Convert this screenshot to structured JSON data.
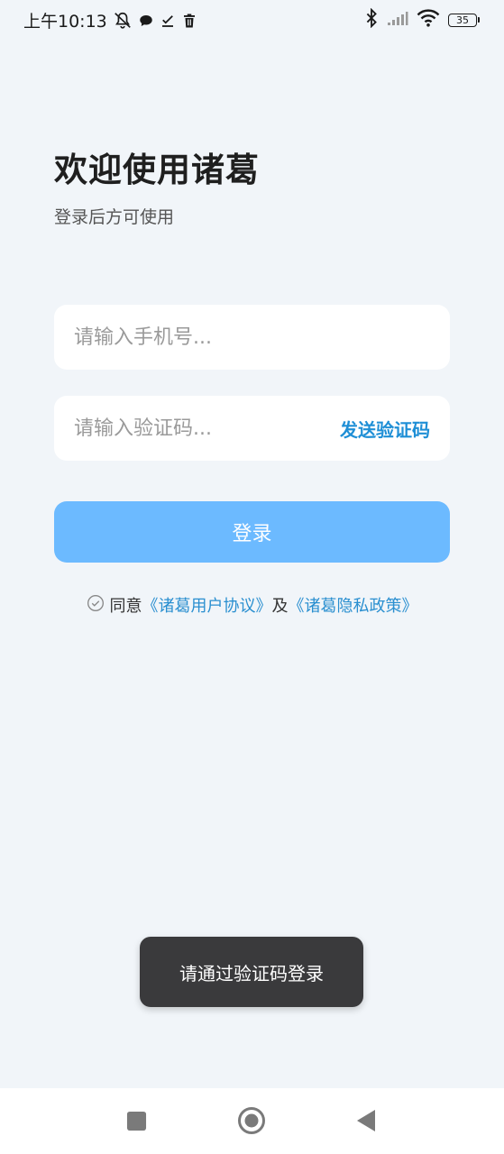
{
  "status_bar": {
    "time": "上午10:13",
    "battery": "35",
    "icons_left": [
      "notifications-off-icon",
      "chat-bubble-icon",
      "check-icon",
      "trash-icon"
    ],
    "icons_right": [
      "bluetooth-icon",
      "signal-icon",
      "wifi-icon",
      "battery-icon"
    ]
  },
  "header": {
    "title": "欢迎使用诸葛",
    "subtitle": "登录后方可使用"
  },
  "form": {
    "phone_placeholder": "请输入手机号...",
    "phone_value": "",
    "code_placeholder": "请输入验证码...",
    "code_value": "",
    "send_code_label": "发送验证码",
    "login_label": "登录"
  },
  "agreement": {
    "prefix": "同意",
    "user_agreement": "《诸葛用户协议》",
    "and": "及",
    "privacy_policy": "《诸葛隐私政策》"
  },
  "toast": {
    "message": "请通过验证码登录"
  },
  "colors": {
    "background": "#f1f5f9",
    "primary_button": "#6cbaff",
    "link": "#2a8fd0",
    "send_code": "#1f8fd6",
    "toast_bg": "#3a3a3c"
  }
}
